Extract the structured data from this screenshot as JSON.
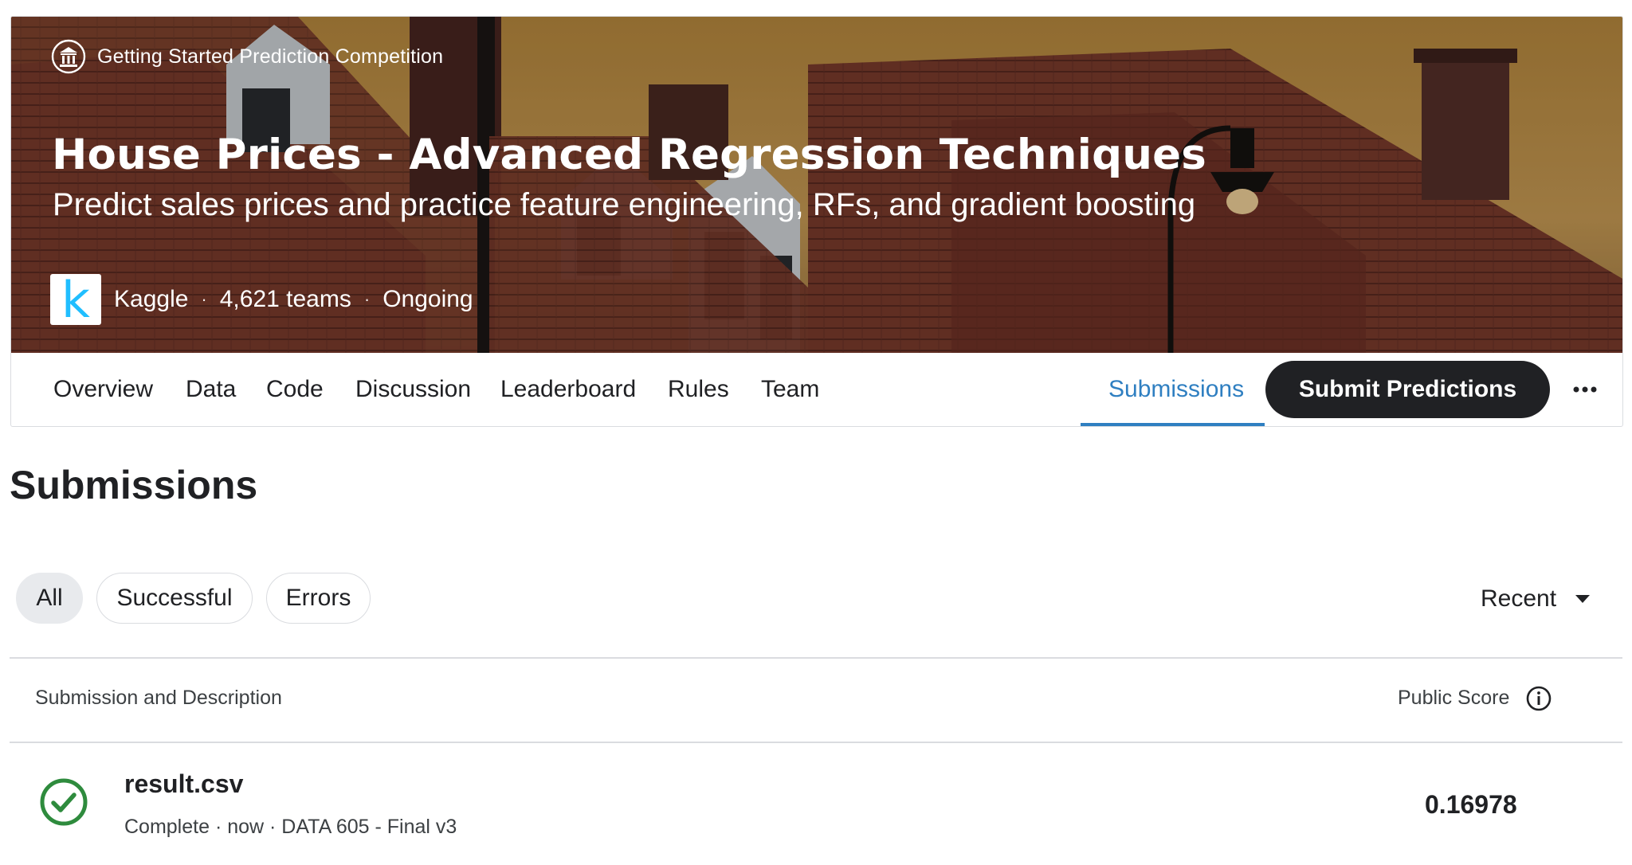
{
  "hero": {
    "competition_type": "Getting Started Prediction Competition",
    "competition_icon": "institution-icon",
    "title": "House Prices - Advanced Regression Techniques",
    "subtitle": "Predict sales prices and practice feature engineering, RFs, and gradient boosting",
    "host_logo_letter": "k",
    "host": "Kaggle",
    "teams": "4,621 teams",
    "status": "Ongoing",
    "colors": {
      "sky": "#c89a45",
      "roof": "#7a3a2a"
    }
  },
  "tabs": {
    "items": [
      "Overview",
      "Data",
      "Code",
      "Discussion",
      "Leaderboard",
      "Rules",
      "Team"
    ],
    "active": "Submissions",
    "submit_label": "Submit Predictions",
    "more_icon": "more-horizontal-icon",
    "accent_color": "#2f7fc1"
  },
  "main": {
    "title": "Submissions",
    "filters": [
      "All",
      "Successful",
      "Errors"
    ],
    "active_filter": "All",
    "sort_label": "Recent",
    "columns": {
      "left": "Submission and Description",
      "right": "Public Score"
    },
    "rows": [
      {
        "status_icon": "check-circle-icon",
        "file": "result.csv",
        "description": "Complete · now · DATA 605 - Final v3",
        "score": "0.16978",
        "status_color": "#2e8b3d"
      }
    ]
  }
}
